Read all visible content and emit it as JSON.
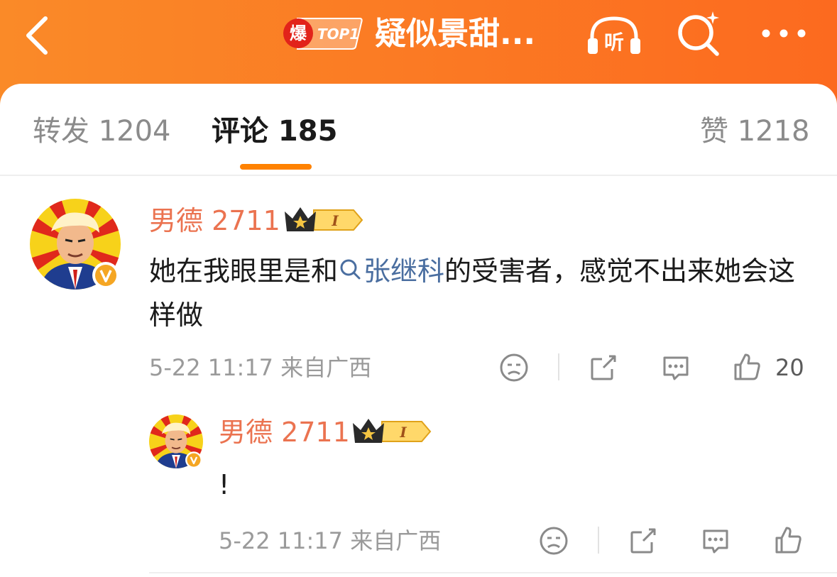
{
  "header": {
    "title": "疑似景甜...",
    "hot_char": "爆",
    "hot_rank": "TOP1",
    "back_icon": "chevron-left-icon",
    "listen_label": "听",
    "colors": {
      "start": "#fa8a28",
      "end": "#fc6a1f"
    }
  },
  "tabs": {
    "repost": "转发 1204",
    "comments": "评论 185",
    "likes": "赞 1218",
    "active_color": "#ff8200"
  },
  "comments": [
    {
      "username": "男德 2711",
      "level": "I",
      "text_before": "她在我眼里是和",
      "topic_link": "张继科",
      "text_after": "的受害者，感觉不出来她会这样做",
      "time": "5-22 11:17",
      "location": "来自广西",
      "likes": "20"
    }
  ],
  "reply": {
    "username": "男德 2711",
    "level": "I",
    "text": "!",
    "time": "5-22 11:17",
    "location": "来自广西"
  }
}
